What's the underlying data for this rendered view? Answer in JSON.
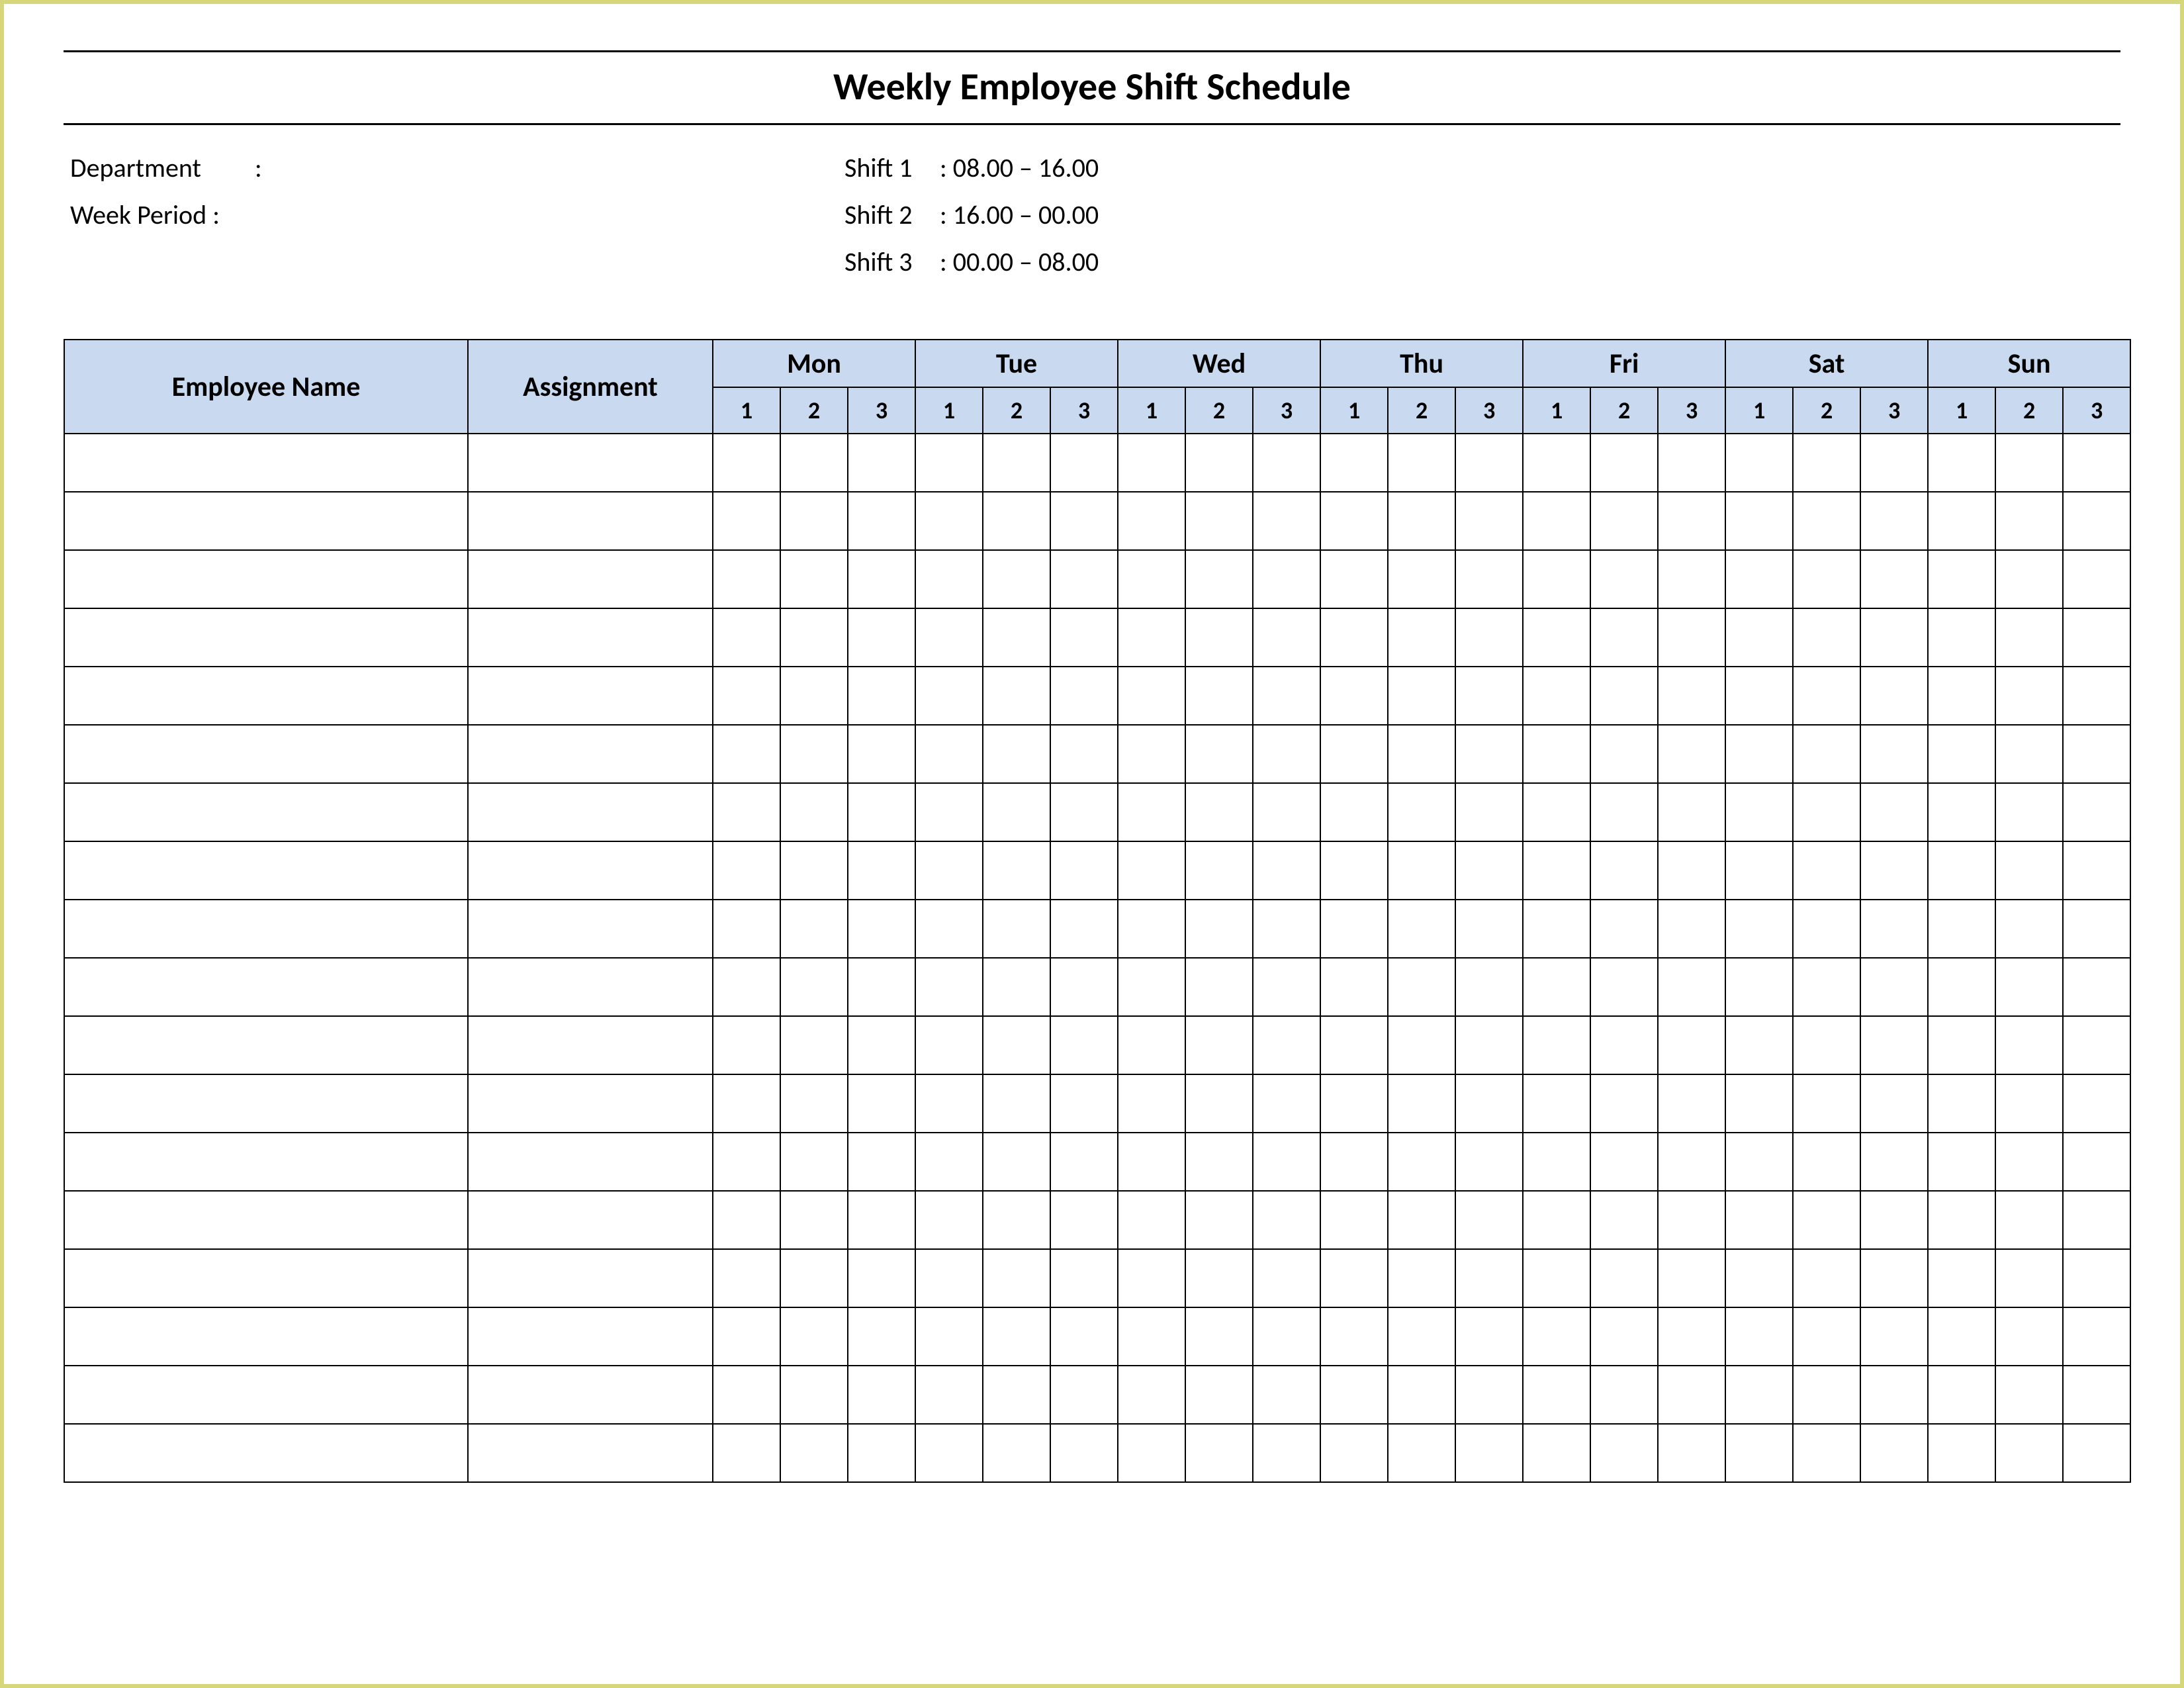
{
  "title": "Weekly Employee Shift Schedule",
  "info": {
    "department_label": "Department",
    "week_period_label": "Week Period :",
    "department_value": ":",
    "shifts": [
      {
        "label": "Shift 1",
        "time": ": 08.00  – 16.00"
      },
      {
        "label": "Shift 2",
        "time": ": 16.00  – 00.00"
      },
      {
        "label": "Shift 3",
        "time": ": 00.00  – 08.00"
      }
    ]
  },
  "table": {
    "employee_name_header": "Employee Name",
    "assignment_header": "Assignment",
    "days": [
      "Mon",
      "Tue",
      "Wed",
      "Thu",
      "Fri",
      "Sat",
      "Sun"
    ],
    "shift_nums": [
      "1",
      "2",
      "3"
    ],
    "row_count": 18
  }
}
